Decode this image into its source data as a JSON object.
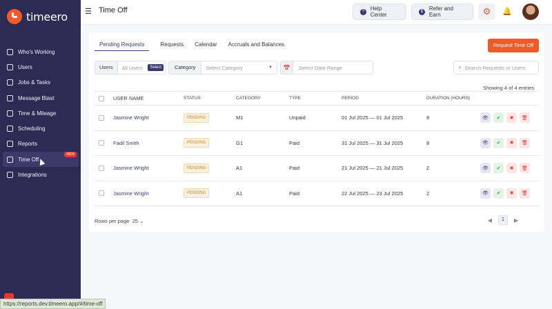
{
  "app": {
    "name": "timeero"
  },
  "sidebar": {
    "items": [
      {
        "label": "Who's Working",
        "icon": "map-pin-icon"
      },
      {
        "label": "Users",
        "icon": "users-icon"
      },
      {
        "label": "Jobs & Tasks",
        "icon": "briefcase-icon"
      },
      {
        "label": "Message Blast",
        "icon": "message-icon"
      },
      {
        "label": "Time & Mileage",
        "icon": "clock-icon"
      },
      {
        "label": "Scheduling",
        "icon": "calendar-icon"
      },
      {
        "label": "Reports",
        "icon": "reports-icon"
      },
      {
        "label": "Time Off",
        "icon": "time-off-icon",
        "badge": "NEW",
        "active": true
      },
      {
        "label": "Integrations",
        "icon": "integrations-icon"
      }
    ]
  },
  "header": {
    "title": "Time Off",
    "help_label": "Help Center",
    "refer_label": "Refer and Earn"
  },
  "tabs": [
    "Pending Requests",
    "Requests",
    "Calendar",
    "Accruals and Balances"
  ],
  "request_button": "Request Time Off",
  "filters": {
    "users_label": "Users",
    "users_placeholder": "All Users",
    "users_select": "Select",
    "category_label": "Category",
    "category_placeholder": "Select Category",
    "date_placeholder": "Select Date Range",
    "search_placeholder": "Search Requests or Users"
  },
  "showing": "Showing 4 of 4 entries",
  "table": {
    "headers": [
      "User Name",
      "Status",
      "Category",
      "Type",
      "Period",
      "Duration (Hours)"
    ],
    "rows": [
      {
        "name": "Jasmine Wright",
        "status": "PENDING",
        "category": "M1",
        "type": "Unpaid",
        "period": "01 Jul 2025 — 01 Jul 2025",
        "duration": "8"
      },
      {
        "name": "Fadil Smith",
        "status": "PENDING",
        "category": "G1",
        "type": "Paid",
        "period": "31 Jul 2025 — 31 Jul 2025",
        "duration": "8"
      },
      {
        "name": "Jasmine Wright",
        "status": "PENDING",
        "category": "A1",
        "type": "Paid",
        "period": "21 Jul 2025 — 21 Jul 2025",
        "duration": "2"
      },
      {
        "name": "Jasmine Wright",
        "status": "PENDING",
        "category": "A1",
        "type": "Paid",
        "period": "22 Jul 2025 — 23 Jul 2025",
        "duration": "2"
      }
    ]
  },
  "pagination": {
    "rows_per_page_label": "Rows per page",
    "rows_per_page": "25",
    "page": "1"
  },
  "status_url": "https://reports.dev.timeero.app/#/time-off",
  "colors": {
    "sidebar": "#2d2b54",
    "accent": "#f15a29",
    "primary": "#3a3870"
  }
}
